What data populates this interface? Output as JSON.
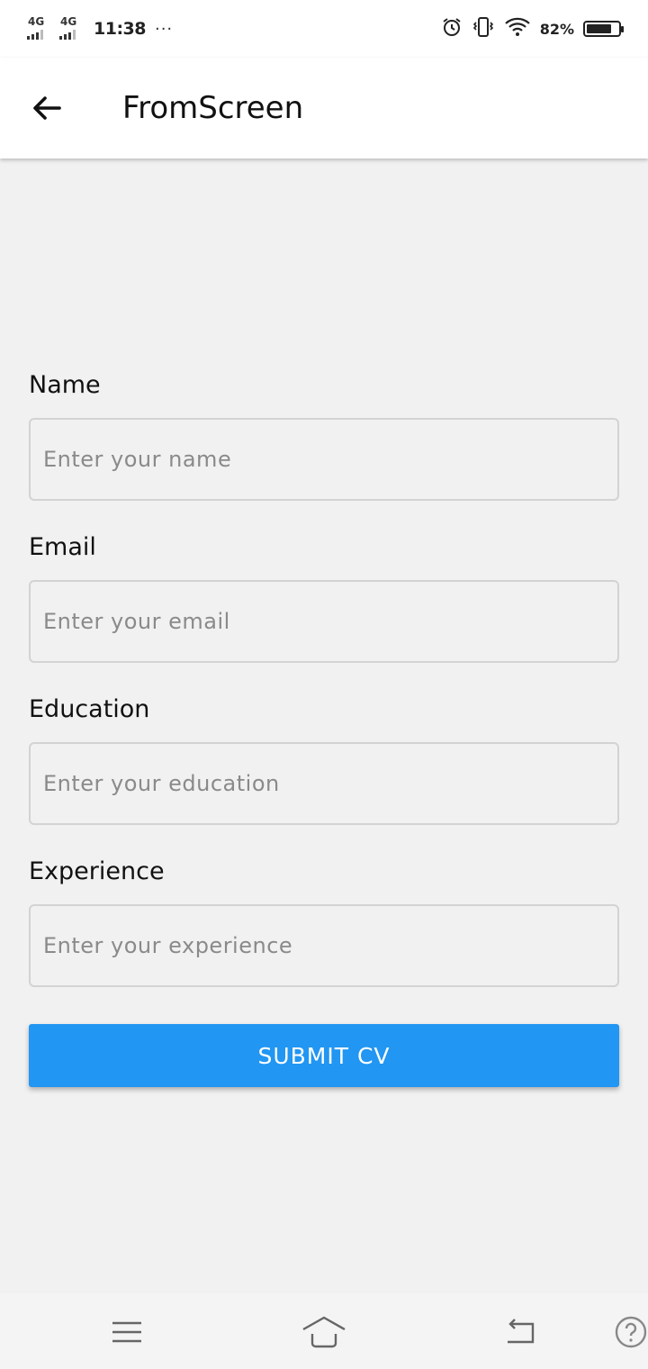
{
  "status_bar": {
    "network1": "4G",
    "network2": "4G",
    "time": "11:38",
    "more": "···",
    "battery_percent": "82%",
    "battery_level": 0.82,
    "icons": [
      "alarm-icon",
      "vibrate-icon",
      "wifi-icon",
      "battery-icon"
    ]
  },
  "app_bar": {
    "title": "FromScreen",
    "back_icon": "arrow-left-icon"
  },
  "form": {
    "fields": [
      {
        "label": "Name",
        "placeholder": "Enter your name",
        "value": ""
      },
      {
        "label": "Email",
        "placeholder": "Enter your email",
        "value": ""
      },
      {
        "label": "Education",
        "placeholder": "Enter your education",
        "value": ""
      },
      {
        "label": "Experience",
        "placeholder": "Enter your experience",
        "value": ""
      }
    ],
    "submit_label": "SUBMIT CV"
  },
  "nav_bar": {
    "icons": [
      "menu-icon",
      "home-icon",
      "back-icon",
      "help-icon"
    ]
  },
  "colors": {
    "accent": "#2196f3",
    "background": "#f1f1f1",
    "appbar": "#ffffff"
  }
}
